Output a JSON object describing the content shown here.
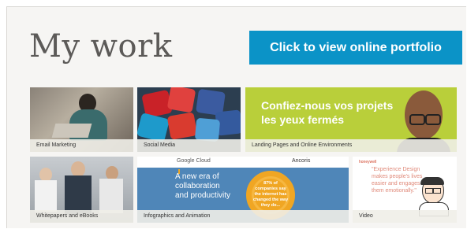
{
  "section": {
    "title": "My work",
    "cta_label": "Click to view online portfolio"
  },
  "tiles": [
    {
      "caption": "Email Marketing"
    },
    {
      "caption": "Social Media"
    },
    {
      "caption": "Landing Pages and Online Environments",
      "headline_1": "Confiez-nous vos projets",
      "headline_2": "les yeux fermés"
    },
    {
      "caption": "Whitepapers and eBooks"
    },
    {
      "caption": "Infographics and Animation",
      "brand": "Google Cloud",
      "brand2": "Ancoris",
      "headline_1": "A new era of",
      "headline_2": "collaboration",
      "headline_3": "and productivity",
      "stat_1": "87% of",
      "stat_2": "companies say",
      "stat_3": "the internet has",
      "stat_4": "changed the way",
      "stat_5": "they do..."
    },
    {
      "caption": "Video",
      "brand": "honeywell",
      "quote_1": "\"Experience Design",
      "quote_2": "makes people's lives",
      "quote_3": "easier and engages",
      "quote_4": "them emotionally.\""
    }
  ],
  "colors": {
    "cta_bg": "#0b93c7",
    "landing_bg": "#b9cf3a",
    "infographic_bg": "#4f86b8",
    "donut": "#f0a623"
  }
}
